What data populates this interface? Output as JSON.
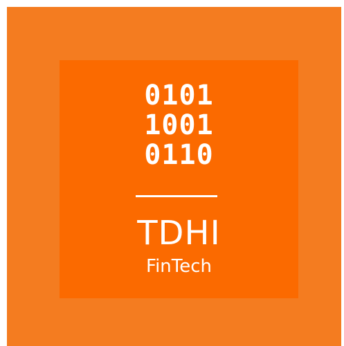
{
  "logo": {
    "binary_rows": [
      "0101",
      "1001",
      "0110"
    ],
    "title": "TDHI",
    "subtitle": "FinTech"
  },
  "colors": {
    "outer_background": "#f47c20",
    "inner_background": "#fb6a00",
    "text": "#ffffff"
  }
}
